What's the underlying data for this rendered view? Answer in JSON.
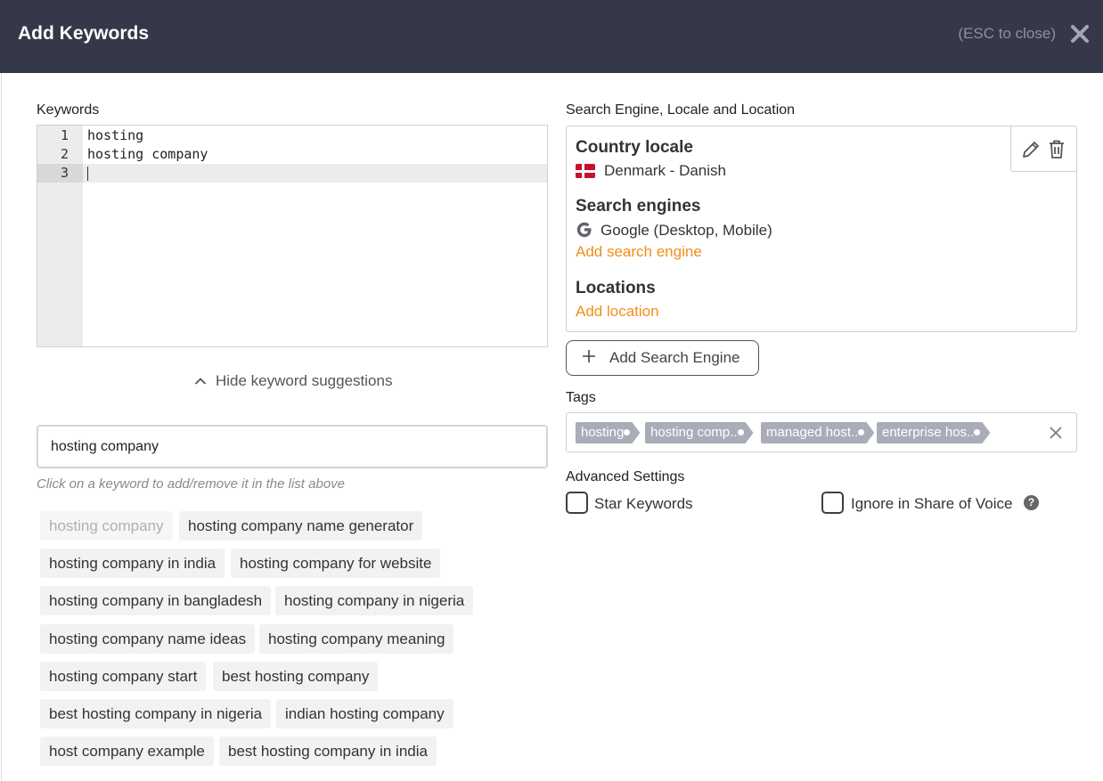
{
  "header": {
    "title": "Add Keywords",
    "esc_hint": "(ESC to close)"
  },
  "keywords": {
    "label": "Keywords",
    "lines": [
      {
        "number": "1",
        "text": "hosting"
      },
      {
        "number": "2",
        "text": "hosting company"
      },
      {
        "number": "3",
        "text": ""
      }
    ]
  },
  "suggestions_toggle": "Hide keyword suggestions",
  "suggestion_search": {
    "value": "hosting company",
    "hint": "Click on a keyword to add/remove it in the list above"
  },
  "suggestions": [
    "hosting company",
    "hosting company name generator",
    "hosting company in india",
    "hosting company for website",
    "hosting company in bangladesh",
    "hosting company in nigeria",
    "hosting company name ideas",
    "hosting company meaning",
    "hosting company start",
    "best hosting company",
    "best hosting company in nigeria",
    "indian hosting company",
    "host company example",
    "best hosting company in india"
  ],
  "search_engine": {
    "label": "Search Engine, Locale and Location",
    "country_heading": "Country locale",
    "country_value": "Denmark - Danish",
    "engines_heading": "Search engines",
    "engines_value": "Google (Desktop, Mobile)",
    "add_engine_link": "Add search engine",
    "locations_heading": "Locations",
    "add_location_link": "Add location"
  },
  "add_search_engine_button": "Add Search Engine",
  "tags": {
    "label": "Tags",
    "items": [
      "hosting",
      "hosting comp..",
      "managed host..",
      "enterprise hos.."
    ]
  },
  "advanced": {
    "label": "Advanced Settings",
    "star_keywords": "Star Keywords",
    "ignore_sov": "Ignore in Share of Voice",
    "help": "?"
  },
  "colors": {
    "header_bg": "#343848",
    "link": "#f38e1b",
    "tag_bg": "#a9adb8"
  }
}
